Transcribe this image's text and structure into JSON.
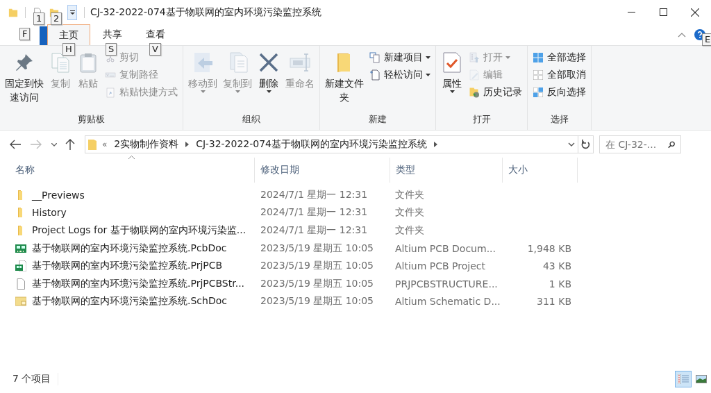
{
  "title_bar": {
    "title": "CJ-32-2022-074基于物联网的室内环境污染监控系统"
  },
  "keytips": [
    {
      "label": "1"
    },
    {
      "label": "2"
    },
    {
      "label": "F"
    },
    {
      "label": "H"
    },
    {
      "label": "S"
    },
    {
      "label": "V"
    },
    {
      "label": "E"
    }
  ],
  "tabs": [
    {
      "label": "主页",
      "selected": true
    },
    {
      "label": "共享",
      "selected": false
    },
    {
      "label": "查看",
      "selected": false
    }
  ],
  "ribbon": {
    "groups": [
      {
        "label": "剪贴板",
        "items": [
          {
            "label": "固定到快速访问",
            "kind": "large",
            "disabled": false,
            "dropdown": false
          },
          {
            "label": "复制",
            "kind": "large",
            "disabled": true,
            "dropdown": false
          },
          {
            "label": "粘贴",
            "kind": "large",
            "disabled": true,
            "dropdown": false
          },
          {
            "label": "剪切",
            "kind": "small",
            "disabled": true,
            "dropdown": false
          },
          {
            "label": "复制路径",
            "kind": "small",
            "disabled": true,
            "dropdown": false
          },
          {
            "label": "粘贴快捷方式",
            "kind": "small",
            "disabled": true,
            "dropdown": false
          }
        ]
      },
      {
        "label": "组织",
        "items": [
          {
            "label": "移动到",
            "kind": "large",
            "disabled": true,
            "dropdown": true
          },
          {
            "label": "复制到",
            "kind": "large",
            "disabled": true,
            "dropdown": true
          },
          {
            "label": "删除",
            "kind": "large",
            "disabled": false,
            "dropdown": true
          },
          {
            "label": "重命名",
            "kind": "large",
            "disabled": true,
            "dropdown": false
          }
        ]
      },
      {
        "label": "新建",
        "items": [
          {
            "label": "新建文件夹",
            "kind": "large",
            "disabled": false,
            "dropdown": false
          },
          {
            "label": "新建项目",
            "kind": "small",
            "disabled": false,
            "dropdown": true
          },
          {
            "label": "轻松访问",
            "kind": "small",
            "disabled": false,
            "dropdown": true
          }
        ]
      },
      {
        "label": "打开",
        "items": [
          {
            "label": "属性",
            "kind": "large",
            "disabled": false,
            "dropdown": true
          },
          {
            "label": "打开",
            "kind": "small",
            "disabled": true,
            "dropdown": true
          },
          {
            "label": "编辑",
            "kind": "small",
            "disabled": true,
            "dropdown": false
          },
          {
            "label": "历史记录",
            "kind": "small",
            "disabled": false,
            "dropdown": false
          }
        ]
      },
      {
        "label": "选择",
        "items": [
          {
            "label": "全部选择",
            "kind": "small",
            "disabled": false,
            "dropdown": false
          },
          {
            "label": "全部取消",
            "kind": "small",
            "disabled": false,
            "dropdown": false
          },
          {
            "label": "反向选择",
            "kind": "small",
            "disabled": false,
            "dropdown": false
          }
        ]
      }
    ]
  },
  "address_bar": {
    "prefix": "«",
    "path": [
      "2实物制作资料",
      "CJ-32-2022-074基于物联网的室内环境污染监控系统"
    ]
  },
  "search": {
    "placeholder": "在 CJ-32-..."
  },
  "columns": [
    {
      "label": "名称",
      "sorted": true
    },
    {
      "label": "修改日期",
      "sorted": false
    },
    {
      "label": "类型",
      "sorted": false
    },
    {
      "label": "大小",
      "sorted": false
    }
  ],
  "files": [
    {
      "name": "__Previews",
      "date": "2024/7/1 星期一 12:31",
      "type": "文件夹",
      "kind": "folder"
    },
    {
      "name": "History",
      "date": "2024/7/1 星期一 12:31",
      "type": "文件夹",
      "kind": "folder"
    },
    {
      "name": "Project Logs for 基于物联网的室内环境污染监...",
      "date": "2024/7/1 星期一 12:31",
      "type": "文件夹",
      "kind": "folder"
    },
    {
      "name": "基于物联网的室内环境污染监控系统.PcbDoc",
      "date": "2023/5/19 星期五 10:05",
      "type": "Altium PCB Docum...",
      "size": "1,948 KB",
      "kind": "pcb"
    },
    {
      "name": "基于物联网的室内环境污染监控系统.PrjPCB",
      "date": "2023/5/19 星期五 10:05",
      "type": "Altium PCB Project",
      "size": "43 KB",
      "kind": "project"
    },
    {
      "name": "基于物联网的室内环境污染监控系统.PrjPCBStr...",
      "date": "2023/5/19 星期五 10:05",
      "type": "PRJPCBSTRUCTURE...",
      "size": "1 KB",
      "kind": "file"
    },
    {
      "name": "基于物联网的室内环境污染监控系统.SchDoc",
      "date": "2023/5/19 星期五 10:05",
      "type": "Altium Schematic D...",
      "size": "311 KB",
      "kind": "schematic"
    }
  ],
  "status_bar": {
    "count": "7 个项目",
    "views": [
      {
        "selected": true
      },
      {
        "selected": false
      }
    ]
  }
}
